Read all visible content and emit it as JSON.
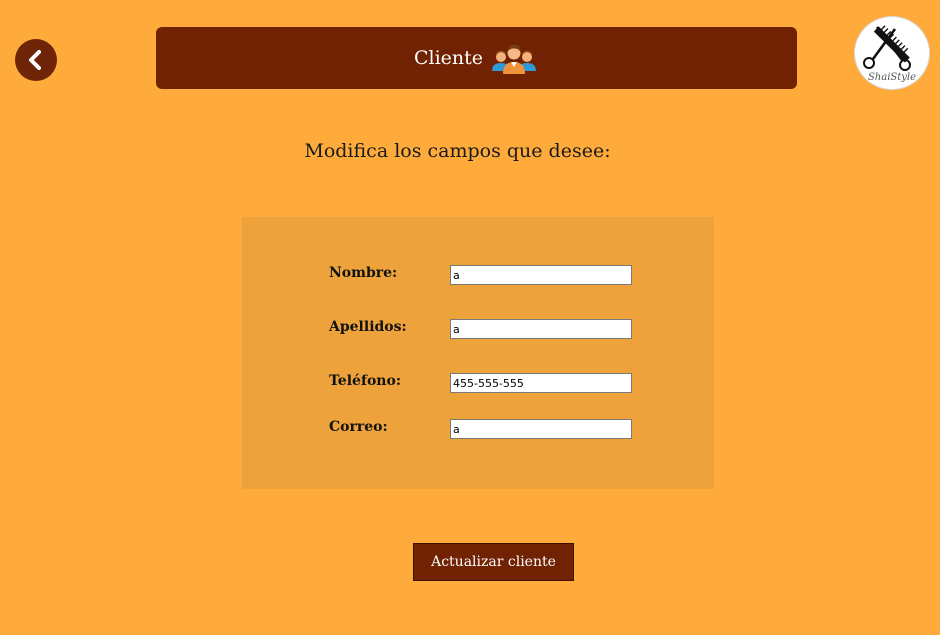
{
  "header": {
    "title": "Cliente",
    "title_icon": "group-of-people-icon",
    "back_icon": "chevron-left-icon"
  },
  "logo": {
    "text": "ShaiStyle",
    "icon": "scissors-and-comb-icon"
  },
  "instructions": "Modifica los campos que desee:",
  "form": {
    "fields": [
      {
        "label": "Nombre:",
        "value": "a"
      },
      {
        "label": "Apellidos:",
        "value": "a"
      },
      {
        "label": "Teléfono:",
        "value": "455-555-555"
      },
      {
        "label": "Correo:",
        "value": "a"
      }
    ]
  },
  "actions": {
    "update_label": "Actualizar cliente"
  },
  "colors": {
    "background": "#ffab3c",
    "header": "#702203",
    "panel": "#eda23b",
    "button": "#702203"
  }
}
